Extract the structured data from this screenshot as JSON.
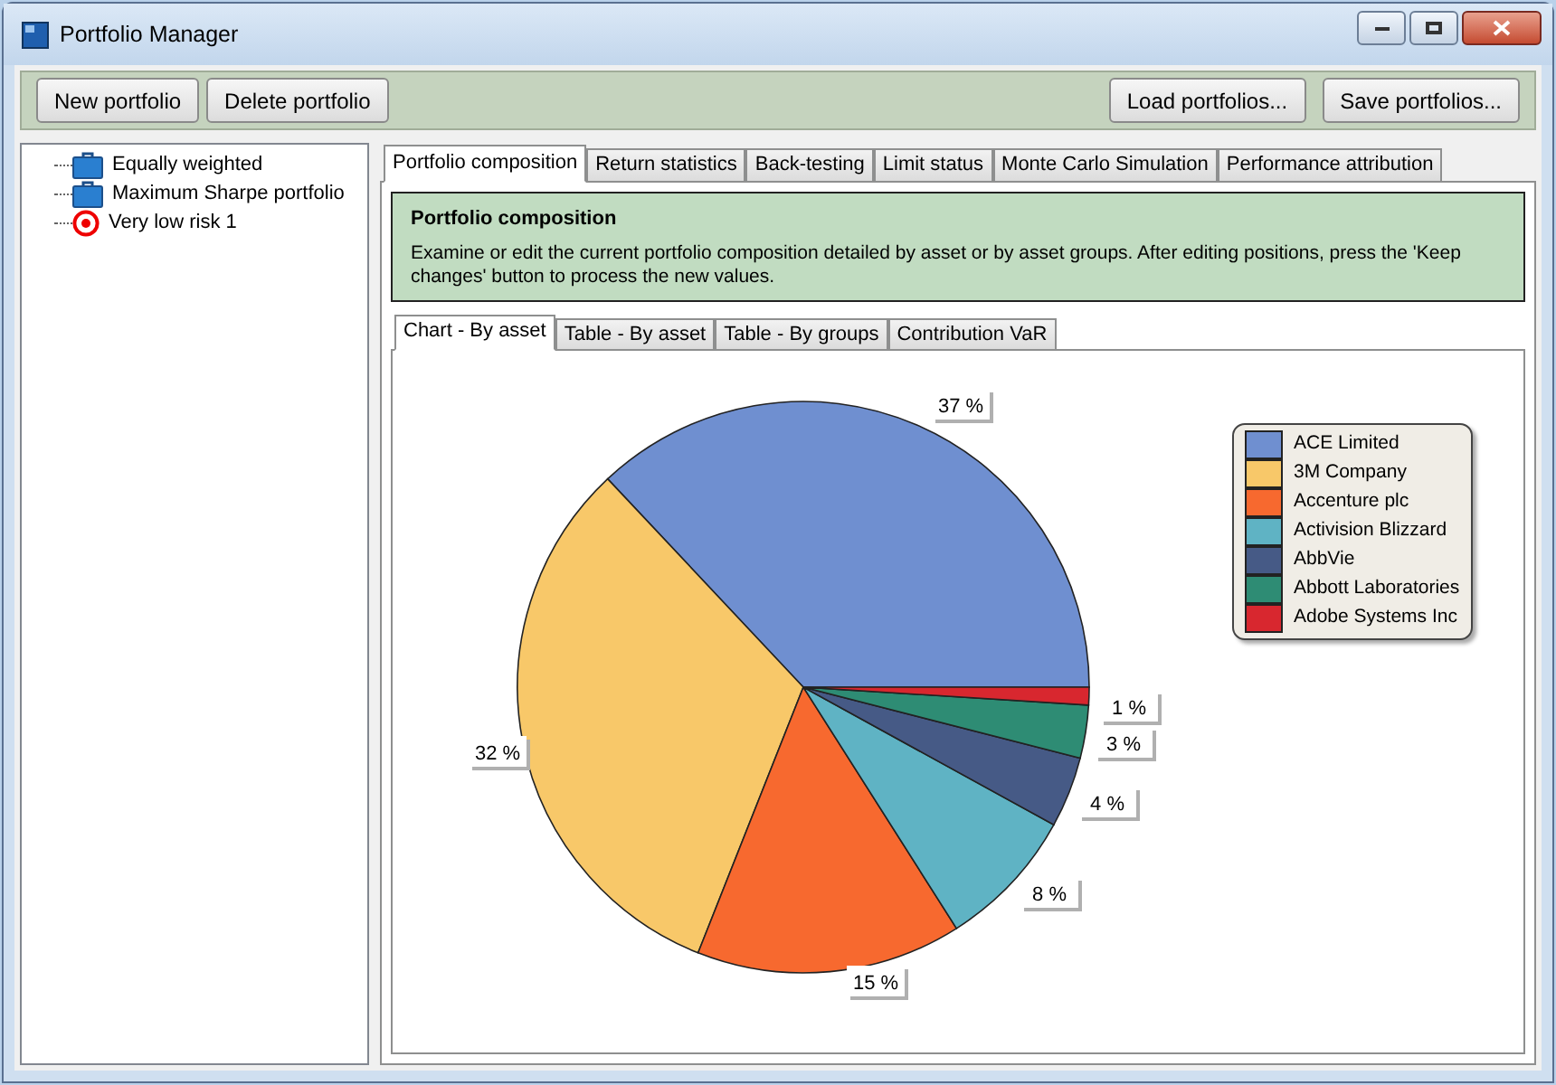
{
  "window": {
    "title": "Portfolio Manager"
  },
  "toolbar": {
    "left_buttons": [
      "New portfolio",
      "Delete portfolio"
    ],
    "right_buttons": [
      "Load portfolios...",
      "Save portfolios..."
    ]
  },
  "tree": {
    "items": [
      {
        "label": "Equally weighted",
        "kind": "briefcase",
        "selected": false
      },
      {
        "label": "Maximum Sharpe portfolio",
        "kind": "briefcase",
        "selected": false
      },
      {
        "label": "Very low risk 1",
        "kind": "target",
        "selected": false
      }
    ]
  },
  "tabs": [
    {
      "label": "Portfolio composition",
      "selected": true
    },
    {
      "label": "Return statistics",
      "selected": false
    },
    {
      "label": "Back-testing",
      "selected": false
    },
    {
      "label": "Limit status",
      "selected": false
    },
    {
      "label": "Monte Carlo Simulation",
      "selected": false
    },
    {
      "label": "Performance attribution",
      "selected": false
    }
  ],
  "info": {
    "title": "Portfolio composition",
    "text": "Examine or edit the current portfolio composition detailed by asset or by asset groups. After editing positions, press the 'Keep changes' button to process the new values."
  },
  "subtabs": [
    {
      "label": "Chart - By asset",
      "selected": true
    },
    {
      "label": "Table - By asset",
      "selected": false
    },
    {
      "label": "Table - By groups",
      "selected": false
    },
    {
      "label": "Contribution VaR",
      "selected": false
    }
  ],
  "chart_data": {
    "type": "pie",
    "categories": [
      "ACE Limited",
      "3M Company",
      "Accenture plc",
      "Activision Blizzard",
      "AbbVie",
      "Abbott Laboratories",
      "Adobe Systems Inc"
    ],
    "series": [
      {
        "colors": [
          "#6f8fd0",
          "#f8c869",
          "#f7692f",
          "#5fb3c4",
          "#465a86",
          "#2e8c74",
          "#d8272f"
        ],
        "values": [
          37,
          32,
          15,
          8,
          4,
          3,
          1
        ]
      }
    ],
    "value_labels": [
      "37 %",
      "32 %",
      "15 %",
      "8 %",
      "4 %",
      "3 %",
      "1 %"
    ]
  }
}
